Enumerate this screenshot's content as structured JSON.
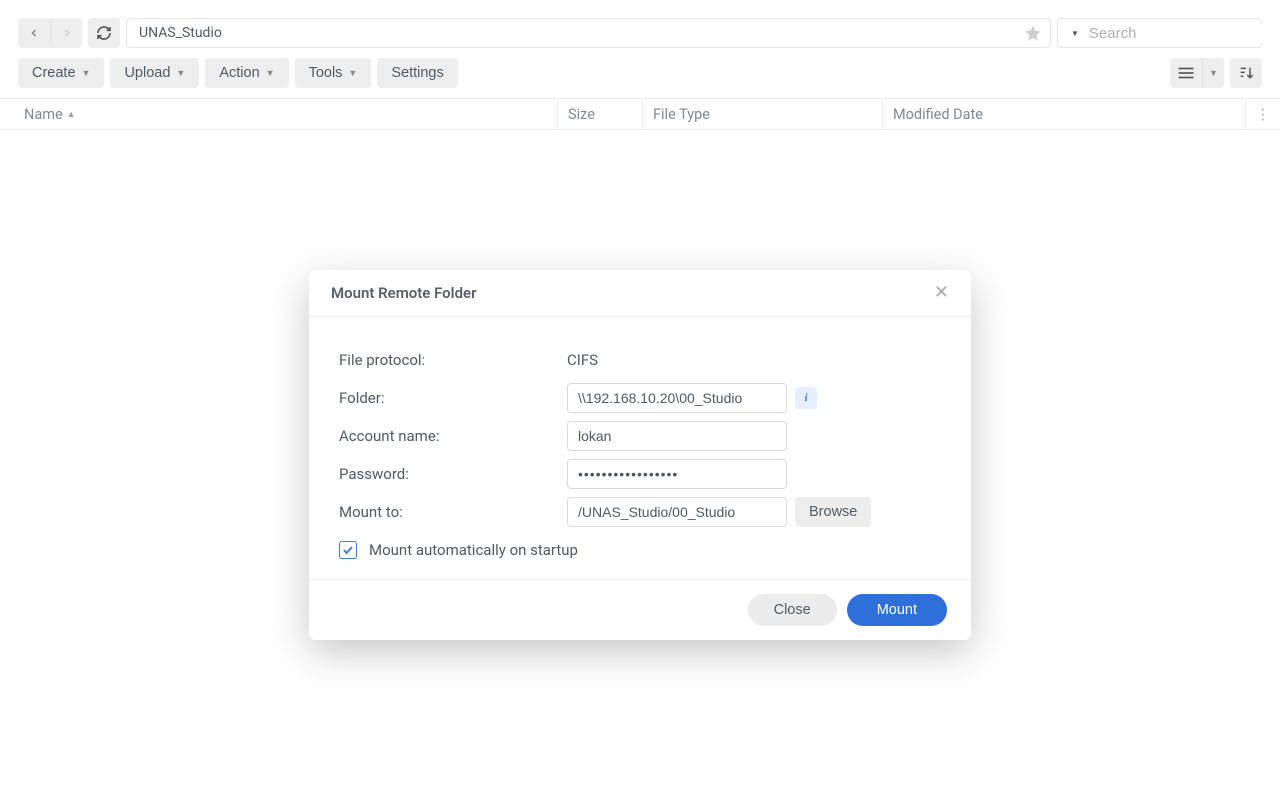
{
  "topbar": {
    "path": "UNAS_Studio",
    "search_placeholder": "Search"
  },
  "toolbar": {
    "create": "Create",
    "upload": "Upload",
    "action": "Action",
    "tools": "Tools",
    "settings": "Settings"
  },
  "table": {
    "cols": {
      "name": "Name",
      "size": "Size",
      "type": "File Type",
      "date": "Modified Date"
    }
  },
  "modal": {
    "title": "Mount Remote Folder",
    "labels": {
      "protocol": "File protocol:",
      "folder": "Folder:",
      "account": "Account name:",
      "password": "Password:",
      "mount_to": "Mount to:"
    },
    "values": {
      "protocol": "CIFS",
      "folder": "\\\\192.168.10.20\\00_Studio",
      "account": "lokan",
      "password": "•••••••••••••••••",
      "mount_to": "/UNAS_Studio/00_Studio"
    },
    "browse": "Browse",
    "auto_mount": "Mount automatically on startup",
    "close": "Close",
    "mount": "Mount"
  }
}
